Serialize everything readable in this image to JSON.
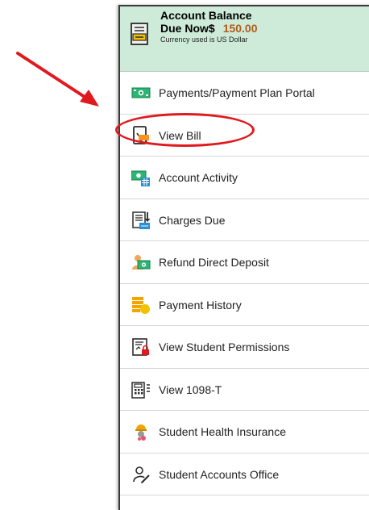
{
  "account": {
    "title": "Account Balance",
    "due_label": "Due Now$",
    "amount": "150.00",
    "currency_note": "Currency used is US Dollar"
  },
  "menu": [
    {
      "label": "Payments/Payment Plan Portal",
      "icon": "money-icon"
    },
    {
      "label": "View Bill",
      "icon": "bill-icon"
    },
    {
      "label": "Account Activity",
      "icon": "account-activity-icon"
    },
    {
      "label": "Charges Due",
      "icon": "charges-due-icon"
    },
    {
      "label": "Refund Direct Deposit",
      "icon": "refund-icon"
    },
    {
      "label": "Payment History",
      "icon": "payment-history-icon"
    },
    {
      "label": "View Student Permissions",
      "icon": "permissions-icon"
    },
    {
      "label": "View 1098-T",
      "icon": "tax-form-icon"
    },
    {
      "label": "Student Health Insurance",
      "icon": "health-insurance-icon"
    },
    {
      "label": "Student Accounts Office",
      "icon": "office-icon"
    }
  ],
  "colors": {
    "header_bg": "#cdebd8",
    "amount": "#b45a1c",
    "annotation": "#e0191f"
  }
}
